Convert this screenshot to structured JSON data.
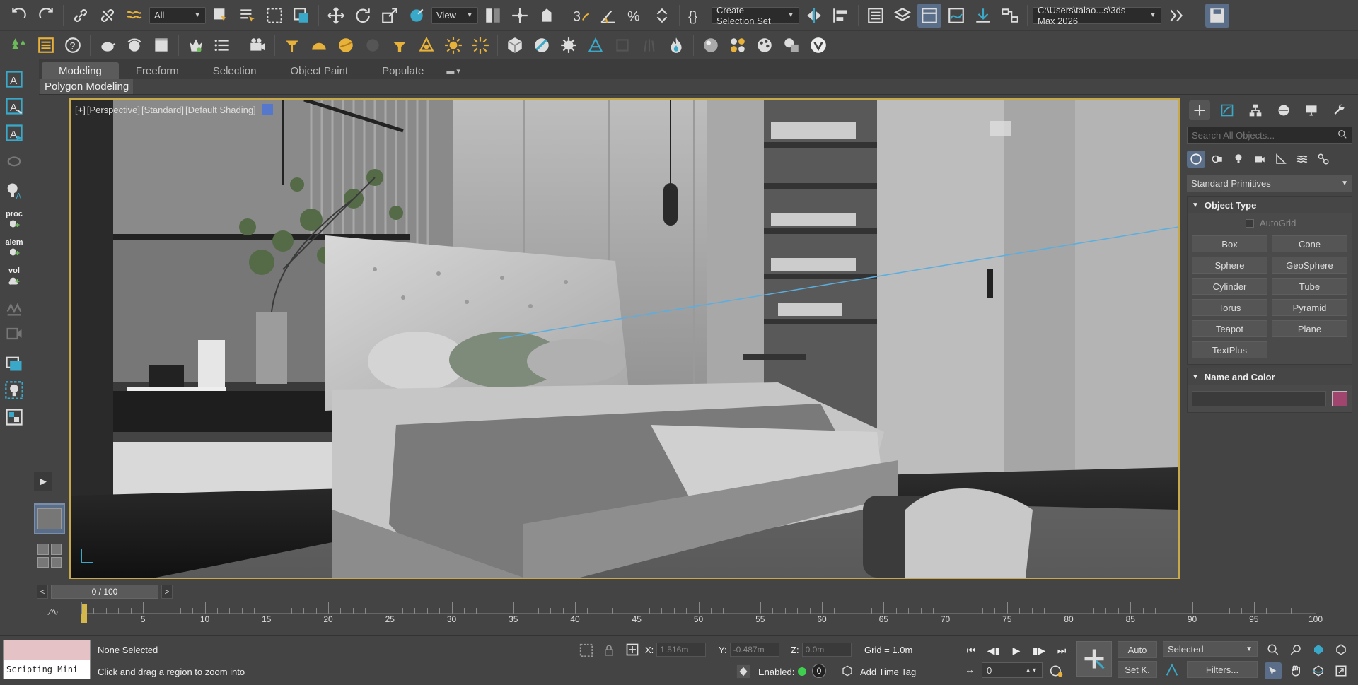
{
  "toolbar": {
    "selection_filter": "All",
    "ref_coord": "View",
    "named_selection": "Create Selection Set",
    "project_path": "C:\\Users\\talao...s\\3ds Max 2026"
  },
  "ribbon": {
    "tabs": [
      "Modeling",
      "Freeform",
      "Selection",
      "Object Paint",
      "Populate"
    ],
    "active_tab": "Modeling",
    "subtitle": "Polygon Modeling"
  },
  "left_toolbar": {
    "labels": [
      "proc",
      "alem",
      "vol"
    ]
  },
  "viewport": {
    "labels": [
      "[+]",
      "[Perspective]",
      "[Standard]",
      "[Default Shading]"
    ]
  },
  "command_panel": {
    "search_placeholder": "Search All Objects...",
    "primitive_type": "Standard Primitives",
    "object_type_title": "Object Type",
    "autogrid": "AutoGrid",
    "buttons": [
      "Box",
      "Cone",
      "Sphere",
      "GeoSphere",
      "Cylinder",
      "Tube",
      "Torus",
      "Pyramid",
      "Teapot",
      "Plane",
      "TextPlus"
    ],
    "name_color_title": "Name and Color",
    "object_color": "#a0456e"
  },
  "timeline": {
    "frame_display": "0 / 100",
    "ticks": [
      "0",
      "5",
      "10",
      "15",
      "20",
      "25",
      "30",
      "35",
      "40",
      "45",
      "50",
      "55",
      "60",
      "65",
      "70",
      "75",
      "80",
      "85",
      "90",
      "95",
      "100"
    ]
  },
  "status": {
    "scripting": "Scripting Mini",
    "selection": "None Selected",
    "prompt": "Click and drag a region to zoom into",
    "x_label": "X:",
    "x_value": "1.516m",
    "y_label": "Y:",
    "y_value": "-0.487m",
    "z_label": "Z:",
    "z_value": "0.0m",
    "grid": "Grid = 1.0m",
    "enabled_label": "Enabled:",
    "enabled_value": "0",
    "add_time_tag": "Add Time Tag",
    "frame_field": "0",
    "auto_btn": "Auto",
    "setk_btn": "Set K.",
    "key_dropdown": "Selected",
    "filters_btn": "Filters..."
  }
}
